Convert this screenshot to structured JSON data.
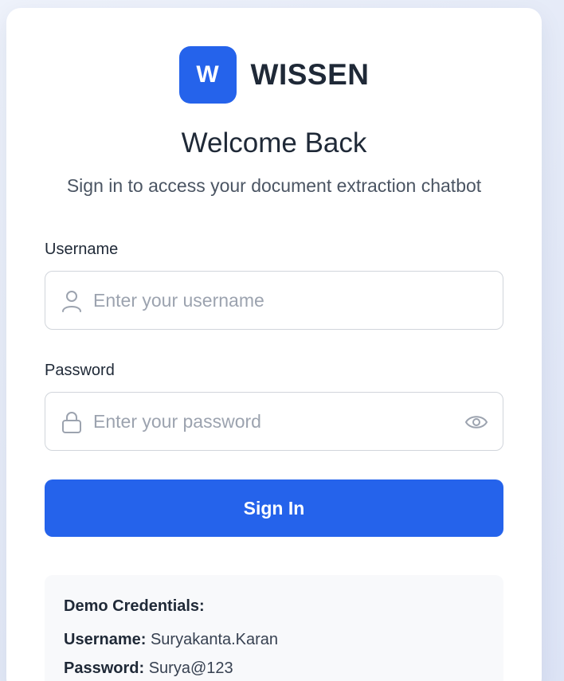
{
  "brand": {
    "logo_letter": "W",
    "name": "WISSEN"
  },
  "heading": {
    "title": "Welcome Back",
    "subtitle": "Sign in to access your document extraction chatbot"
  },
  "form": {
    "username": {
      "label": "Username",
      "placeholder": "Enter your username",
      "value": "",
      "icon": "user-icon"
    },
    "password": {
      "label": "Password",
      "placeholder": "Enter your password",
      "value": "",
      "icon": "lock-icon",
      "toggle_icon": "eye-icon"
    },
    "submit_label": "Sign In"
  },
  "demo": {
    "title": "Demo Credentials:",
    "username_label": "Username:",
    "username_value": "Suryakanta.Karan",
    "password_label": "Password:",
    "password_value": "Surya@123"
  },
  "colors": {
    "accent": "#2563eb",
    "text": "#1f2937",
    "muted": "#9ca3af",
    "border": "#d1d5db",
    "panel": "#f8f9fb"
  }
}
